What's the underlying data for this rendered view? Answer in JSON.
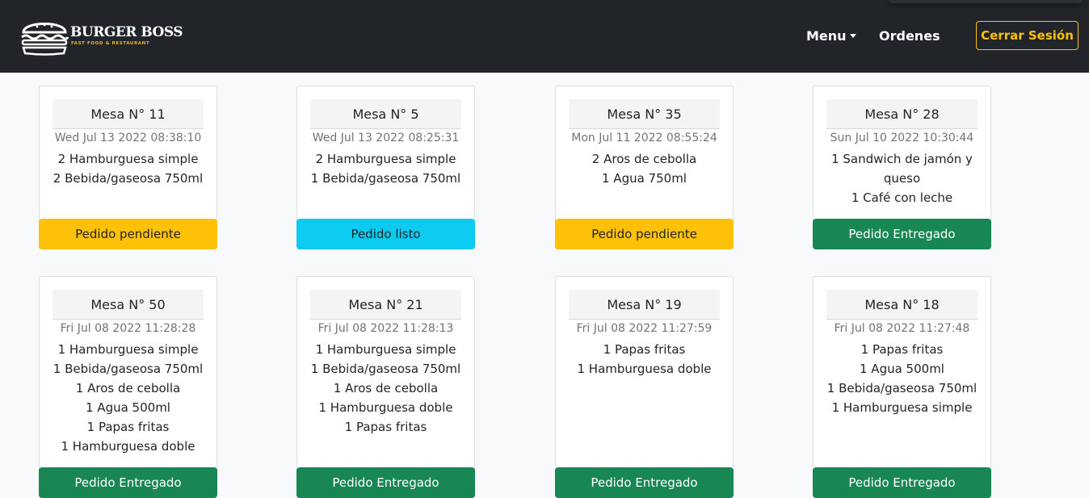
{
  "brand": {
    "title": "BURGER BOSS",
    "subtitle": "FAST FOOD & RESTAURANT",
    "logo_icon": "burger-icon"
  },
  "nav": {
    "menu_label": "Menu",
    "orders_label": "Ordenes",
    "logout_label": "Cerrar Sesión"
  },
  "colors": {
    "navbar": "#212529",
    "accent": "#ffc107",
    "pending": "#ffc107",
    "ready": "#0dcaf0",
    "delivered": "#198754"
  },
  "orders": [
    {
      "mesa": "Mesa N° 11",
      "date": "Wed Jul 13 2022 08:38:10",
      "items": [
        "2 Hamburguesa simple",
        "2 Bebida/gaseosa 750ml"
      ],
      "status": "Pedido pendiente",
      "status_key": "pendiente"
    },
    {
      "mesa": "Mesa N° 5",
      "date": "Wed Jul 13 2022 08:25:31",
      "items": [
        "2 Hamburguesa simple",
        "1 Bebida/gaseosa 750ml"
      ],
      "status": "Pedido listo",
      "status_key": "listo"
    },
    {
      "mesa": "Mesa N° 35",
      "date": "Mon Jul 11 2022 08:55:24",
      "items": [
        "2 Aros de cebolla",
        "1 Agua 750ml"
      ],
      "status": "Pedido pendiente",
      "status_key": "pendiente"
    },
    {
      "mesa": "Mesa N° 28",
      "date": "Sun Jul 10 2022 10:30:44",
      "items": [
        "1 Sandwich de jamón y queso",
        "1 Café con leche"
      ],
      "status": "Pedido Entregado",
      "status_key": "entregado"
    },
    {
      "mesa": "Mesa N° 50",
      "date": "Fri Jul 08 2022 11:28:28",
      "items": [
        "1 Hamburguesa simple",
        "1 Bebida/gaseosa 750ml",
        "1 Aros de cebolla",
        "1 Agua 500ml",
        "1 Papas fritas",
        "1 Hamburguesa doble"
      ],
      "status": "Pedido Entregado",
      "status_key": "entregado"
    },
    {
      "mesa": "Mesa N° 21",
      "date": "Fri Jul 08 2022 11:28:13",
      "items": [
        "1 Hamburguesa simple",
        "1 Bebida/gaseosa 750ml",
        "1 Aros de cebolla",
        "1 Hamburguesa doble",
        "1 Papas fritas"
      ],
      "status": "Pedido Entregado",
      "status_key": "entregado"
    },
    {
      "mesa": "Mesa N° 19",
      "date": "Fri Jul 08 2022 11:27:59",
      "items": [
        "1 Papas fritas",
        "1 Hamburguesa doble"
      ],
      "status": "Pedido Entregado",
      "status_key": "entregado"
    },
    {
      "mesa": "Mesa N° 18",
      "date": "Fri Jul 08 2022 11:27:48",
      "items": [
        "1 Papas fritas",
        "1 Agua 500ml",
        "1 Bebida/gaseosa 750ml",
        "1 Hamburguesa simple"
      ],
      "status": "Pedido Entregado",
      "status_key": "entregado"
    }
  ]
}
